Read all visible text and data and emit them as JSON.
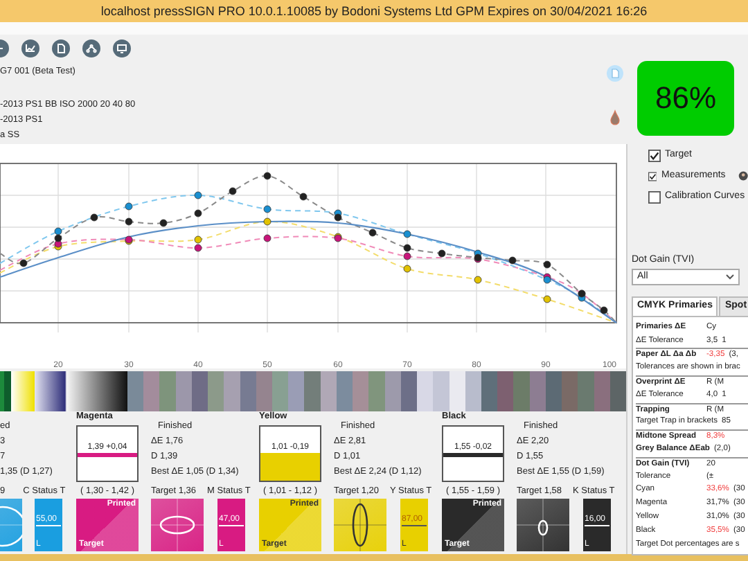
{
  "window": {
    "title": "localhost pressSIGN PRO 10.0.1.10085 by Bodoni Systems Ltd GPM Expires on 30/04/2021 16:26"
  },
  "job_info": [
    "G7 001 (Beta Test)",
    "-2013 PS1 BB ISO 2000 20 40 80",
    "-2013 PS1",
    "a SS"
  ],
  "score": {
    "value": "86%"
  },
  "chart": {
    "x_axis_labels": [
      "20",
      "30",
      "40",
      "50",
      "60",
      "70",
      "80",
      "90",
      "100"
    ]
  },
  "legend": [
    {
      "label": "Target",
      "checked": true
    },
    {
      "label": "Measurements",
      "checked": true
    },
    {
      "label": "Calibration Curves",
      "checked": false
    }
  ],
  "dot_gain_filter": {
    "label": "Dot Gain (TVI)",
    "value": "All"
  },
  "tabs": [
    {
      "label": "CMYK Primaries",
      "selected": true
    },
    {
      "label": "Spot",
      "selected": false
    }
  ],
  "results_table": {
    "rows": [
      {
        "kind": "section",
        "label": "Primaries ΔE",
        "values": [
          {
            "text": "Cy",
            "alert": false
          }
        ]
      },
      {
        "kind": "plain",
        "label": "ΔE Tolerance",
        "values": [
          {
            "text": "3,5",
            "alert": false
          },
          {
            "text": "1",
            "alert": false
          }
        ]
      },
      {
        "kind": "section",
        "label": "Paper ΔL Δa Δb",
        "values": [
          {
            "text": "-3,35",
            "alert": true
          },
          {
            "text": "(3,",
            "alert": false
          }
        ]
      },
      {
        "kind": "note",
        "label": "Tolerances are shown in brac",
        "values": []
      },
      {
        "kind": "section",
        "label": "Overprint ΔE",
        "values": [
          {
            "text": "R (M",
            "alert": false
          }
        ]
      },
      {
        "kind": "plain",
        "label": "ΔE Tolerance",
        "values": [
          {
            "text": "4,0",
            "alert": false
          },
          {
            "text": "1",
            "alert": false
          }
        ]
      },
      {
        "kind": "section",
        "label": "Trapping",
        "values": [
          {
            "text": "R (M",
            "alert": false
          }
        ]
      },
      {
        "kind": "plain",
        "label": "Target Trap in brackets",
        "values": [
          {
            "text": "85",
            "alert": false
          }
        ]
      },
      {
        "kind": "section",
        "label": "Midtone Spread",
        "values": [
          {
            "text": "8,3%",
            "alert": true
          }
        ]
      },
      {
        "kind": "bold",
        "label": "Grey Balance ΔEab",
        "values": [
          {
            "text": "(2,0)",
            "alert": false
          }
        ]
      },
      {
        "kind": "section",
        "label": "Dot Gain (TVI)",
        "values": [
          {
            "text": "20",
            "alert": false
          }
        ]
      },
      {
        "kind": "plain",
        "label": "Tolerance",
        "values": [
          {
            "text": "(±",
            "alert": false
          }
        ]
      },
      {
        "kind": "plain",
        "label": "Cyan",
        "values": [
          {
            "text": "33,6%",
            "alert": true
          },
          {
            "text": "(30",
            "alert": false
          }
        ]
      },
      {
        "kind": "plain",
        "label": "Magenta",
        "values": [
          {
            "text": "31,7%",
            "alert": false
          },
          {
            "text": "(30",
            "alert": false
          }
        ]
      },
      {
        "kind": "plain",
        "label": "Yellow",
        "values": [
          {
            "text": "31,0%",
            "alert": false
          },
          {
            "text": "(30",
            "alert": false
          }
        ]
      },
      {
        "kind": "plain",
        "label": "Black",
        "values": [
          {
            "text": "35,5%",
            "alert": true
          },
          {
            "text": "(30",
            "alert": false
          }
        ]
      },
      {
        "kind": "note",
        "label": "Target Dot percentages are s",
        "values": []
      }
    ]
  },
  "ink_sections": [
    {
      "kind": "partial",
      "stats": [
        "ed",
        "3",
        "7",
        "1,35 (D 1,27)"
      ],
      "target": "9",
      "status_label": "C Status T",
      "status_value": "55,00",
      "status_axis": "L",
      "color": "#1a9ee0"
    },
    {
      "kind": "full",
      "name": "Magenta",
      "reading": "1,39 +0,04",
      "meter": {
        "kind": "line"
      },
      "range": "( 1,30 - 1,42 )",
      "stats": [
        "Finished",
        "ΔE 1,76",
        "D 1,39",
        "Best ΔE 1,05 (D 1,34)"
      ],
      "target": "Target 1,36",
      "status_label": "M Status T",
      "swatch_labels": [
        "Printed",
        "Target"
      ],
      "status_value": "47,00",
      "status_axis": "L",
      "color": "#d81b82"
    },
    {
      "kind": "full",
      "name": "Yellow",
      "reading": "1,01 -0,19",
      "meter": {
        "kind": "fill"
      },
      "range": "( 1,01 - 1,12 )",
      "stats": [
        "Finished",
        "ΔE 2,81",
        "D 1,01",
        "Best ΔE 2,24 (D 1,12)"
      ],
      "target": "Target 1,20",
      "status_label": "Y Status T",
      "swatch_labels": [
        "Printed",
        "Target"
      ],
      "status_value": "87,00",
      "status_axis": "L",
      "color": "#e8d000"
    },
    {
      "kind": "full",
      "name": "Black",
      "reading": "1,55 -0,02",
      "meter": {
        "kind": "line"
      },
      "range": "( 1,55 - 1,59 )",
      "stats": [
        "Finished",
        "ΔE 2,20",
        "D 1,55",
        "Best ΔE 1,55 (D 1,59)"
      ],
      "target": "Target 1,58",
      "status_label": "K Status T",
      "swatch_labels": [
        "Printed",
        "Target"
      ],
      "status_value": "16,00",
      "status_axis": "L",
      "color": "#2a2a2a"
    }
  ]
}
